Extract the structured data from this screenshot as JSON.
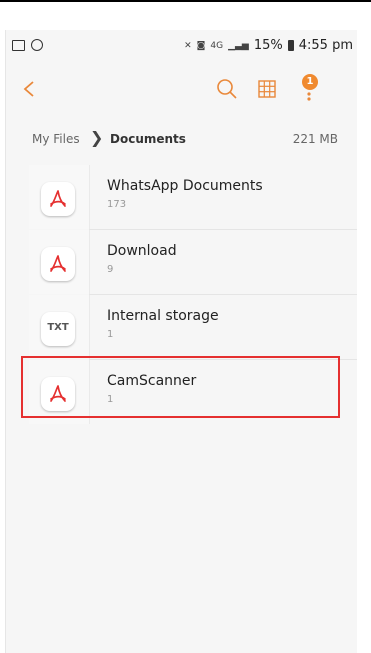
{
  "status_bar": {
    "network": "4G",
    "battery": "15%",
    "time": "4:55 pm"
  },
  "app_bar": {
    "back_icon": "chevron-left-icon",
    "notification_count": "1",
    "accent_color": "#e9883a"
  },
  "breadcrumb": {
    "root": "My Files",
    "current": "Documents",
    "size": "221 MB"
  },
  "files": [
    {
      "name": "WhatsApp Documents",
      "count": "173",
      "icon": "pdf-icon"
    },
    {
      "name": "Download",
      "count": "9",
      "icon": "pdf-icon"
    },
    {
      "name": "Internal storage",
      "count": "1",
      "icon": "txt-icon",
      "icon_label": "TXT"
    },
    {
      "name": "CamScanner",
      "count": "1",
      "icon": "pdf-icon"
    }
  ],
  "highlight_color": "#e53030"
}
